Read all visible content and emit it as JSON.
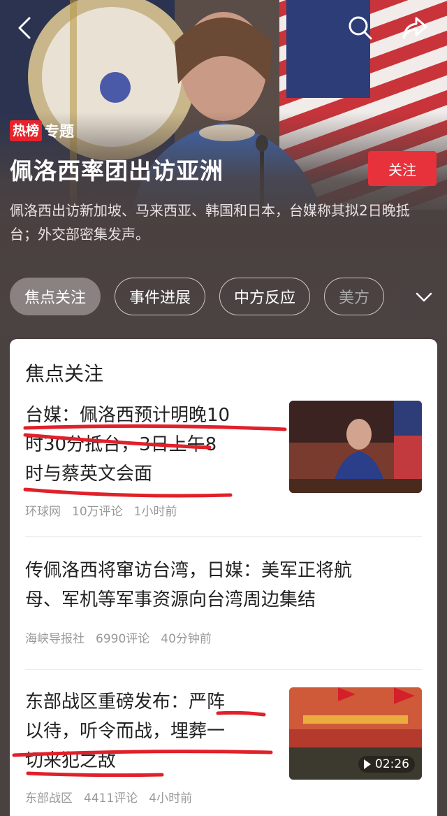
{
  "header": {
    "hot_badge": "热榜",
    "tag": "专题",
    "title": "佩洛西率团出访亚洲",
    "follow_label": "关注",
    "description": "佩洛西出访新加坡、马来西亚、韩国和日本，台媒称其拟2日晚抵台；外交部密集发声。"
  },
  "tabs": [
    {
      "label": "焦点关注",
      "active": true
    },
    {
      "label": "事件进展",
      "active": false
    },
    {
      "label": "中方反应",
      "active": false
    },
    {
      "label": "美方",
      "active": false
    }
  ],
  "section": {
    "title": "焦点关注",
    "items": [
      {
        "headline": "台媒：佩洛西预计明晚10时30分抵台，3日上午8时与蔡英文会面",
        "line1": "台媒：佩洛西预计明晚10",
        "line2": "时30分抵台，3日上午8",
        "line3": "时与蔡英文会面",
        "source": "环球网",
        "comments": "10万评论",
        "time": "1小时前"
      },
      {
        "line1": "传佩洛西将窜访台湾，日媒：美军正将航",
        "line2": "母、军机等军事资源向台湾周边集结",
        "source": "海峡导报社",
        "comments": "6990评论",
        "time": "40分钟前"
      },
      {
        "line1": "东部战区重磅发布：严阵",
        "line2": "以待，听令而战，埋葬一",
        "line3": "切来犯之敌",
        "source": "东部战区",
        "comments": "4411评论",
        "time": "4小时前",
        "video_duration": "02:26"
      }
    ]
  },
  "colors": {
    "accent_red": "#e8323b",
    "background": "#4a4141",
    "markup_red": "#e0202a"
  },
  "icons": [
    "back-arrow-icon",
    "search-icon",
    "share-icon",
    "chevron-down-icon",
    "play-icon"
  ]
}
